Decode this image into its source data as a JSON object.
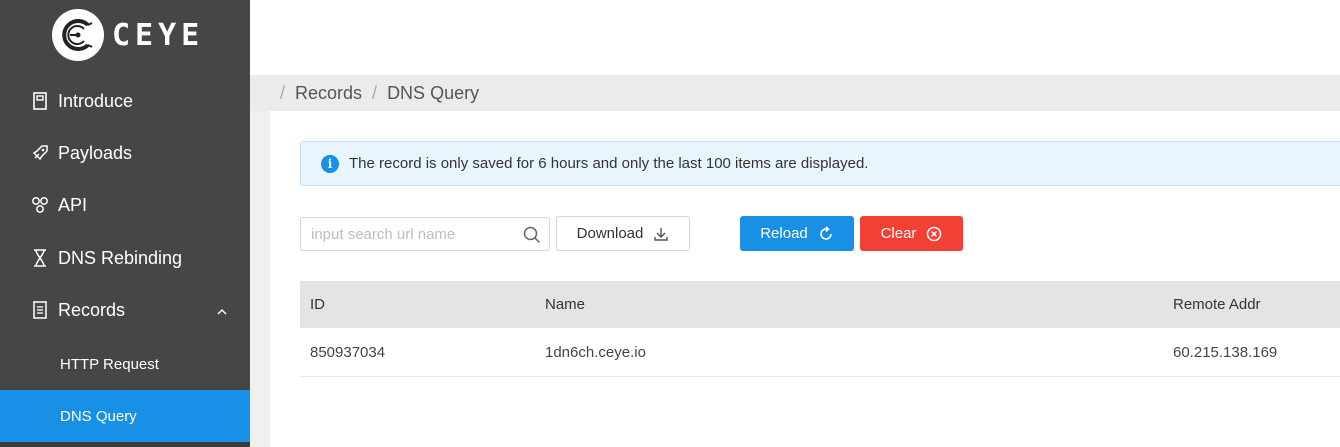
{
  "logo": {
    "text": "CEYE"
  },
  "sidebar": {
    "items": [
      {
        "label": "Introduce",
        "icon": "book-icon"
      },
      {
        "label": "Payloads",
        "icon": "rocket-icon"
      },
      {
        "label": "API",
        "icon": "api-icon"
      },
      {
        "label": "DNS Rebinding",
        "icon": "hourglass-icon"
      },
      {
        "label": "Records",
        "icon": "document-icon",
        "expanded": true
      }
    ],
    "sub_items": [
      {
        "label": "HTTP Request",
        "active": false
      },
      {
        "label": "DNS Query",
        "active": true
      }
    ]
  },
  "breadcrumb": {
    "items": [
      "Records",
      "DNS Query"
    ],
    "separator": "/"
  },
  "alert": {
    "text": "The record is only saved for 6 hours and only the last 100 items are displayed.",
    "icon": "info-icon"
  },
  "search": {
    "placeholder": "input search url name",
    "value": ""
  },
  "toolbar": {
    "download_label": "Download",
    "reload_label": "Reload",
    "clear_label": "Clear"
  },
  "table": {
    "columns": [
      "ID",
      "Name",
      "Remote Addr"
    ],
    "rows": [
      [
        "850937034",
        "1dn6ch.ceye.io",
        "60.215.138.169"
      ]
    ]
  },
  "colors": {
    "sidebar_bg": "#464646",
    "active": "#1890e6",
    "danger": "#f04134"
  }
}
